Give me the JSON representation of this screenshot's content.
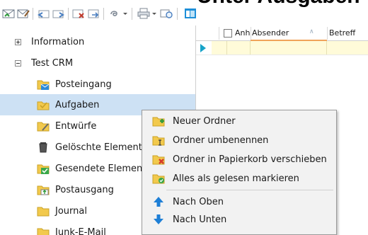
{
  "window": {
    "title_clip": "Unter Ausgaben"
  },
  "toolbar": {
    "buttons": [
      {
        "name": "check-mail-icon"
      },
      {
        "name": "compose-icon"
      },
      {
        "name": "reply-icon"
      },
      {
        "name": "forward-icon"
      },
      {
        "name": "delete-mail-icon"
      },
      {
        "name": "move-mail-icon"
      },
      {
        "name": "attach-icon"
      },
      {
        "name": "dropdown-icon"
      },
      {
        "name": "print-icon"
      },
      {
        "name": "dropdown-icon"
      },
      {
        "name": "view-icon"
      },
      {
        "name": "panel-icon"
      }
    ]
  },
  "tree": {
    "items": [
      {
        "label": "Information",
        "expander": "plus",
        "icon": null,
        "level": 0
      },
      {
        "label": "Test CRM",
        "expander": "minus",
        "icon": null,
        "level": 0
      },
      {
        "label": "Posteingang",
        "icon": "inbox-folder-icon",
        "level": 1
      },
      {
        "label": "Aufgaben",
        "icon": "tasks-folder-icon",
        "level": 1,
        "selected": true
      },
      {
        "label": "Entwürfe",
        "icon": "drafts-folder-icon",
        "level": 1
      },
      {
        "label": "Gelöschte Elemente",
        "icon": "trash-icon",
        "level": 1
      },
      {
        "label": "Gesendete Elemente",
        "icon": "sent-folder-icon",
        "level": 1
      },
      {
        "label": "Postausgang",
        "icon": "outbox-folder-icon",
        "level": 1
      },
      {
        "label": "Journal",
        "icon": "folder-icon",
        "level": 1
      },
      {
        "label": "Junk-E-Mail",
        "icon": "folder-icon",
        "level": 1
      }
    ]
  },
  "grid": {
    "columns": [
      "Anhang",
      "Absender",
      "Betreff"
    ],
    "sort_indicator": "∧"
  },
  "context_menu": {
    "items": [
      {
        "label": "Neuer Ordner",
        "icon": "new-folder-icon"
      },
      {
        "label": "Ordner umbenennen",
        "icon": "rename-folder-icon"
      },
      {
        "label": "Ordner in Papierkorb verschieben",
        "icon": "delete-folder-icon"
      },
      {
        "label": "Alles als gelesen markieren",
        "icon": "mark-read-folder-icon"
      },
      {
        "label": "Nach Oben",
        "icon": "arrow-up-icon"
      },
      {
        "label": "Nach Unten",
        "icon": "arrow-down-icon"
      }
    ]
  },
  "colors": {
    "selection": "#cde1f4",
    "menu_bg": "#f2f2f2",
    "folder": "#f2c94c",
    "accent_blue": "#1e7fd6",
    "sort_accent": "#f0a35a",
    "new_row": "#fffbd9"
  }
}
